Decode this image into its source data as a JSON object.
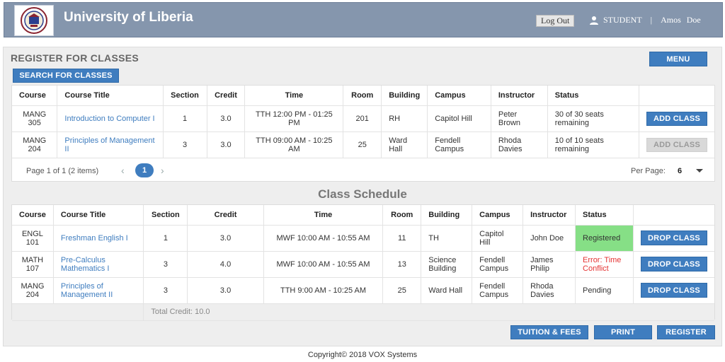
{
  "header": {
    "app_title": "University of Liberia",
    "logout_label": "Log Out",
    "role": "STUDENT",
    "separator": "|",
    "first_name": "Amos",
    "last_name": "Doe"
  },
  "register": {
    "title": "REGISTER FOR CLASSES",
    "menu_label": "MENU",
    "search_label": "SEARCH FOR CLASSES",
    "columns": [
      "Course",
      "Course Title",
      "Section",
      "Credit",
      "Time",
      "Room",
      "Building",
      "Campus",
      "Instructor",
      "Status"
    ],
    "rows": [
      {
        "course": "MANG 305",
        "title": "Introduction to Computer I",
        "section": "1",
        "credit": "3.0",
        "time": "TTH 12:00 PM - 01:25 PM",
        "room": "201",
        "building": "RH",
        "campus": "Capitol Hill",
        "instructor": "Peter Brown",
        "status": "30 of 30 seats remaining",
        "action": "ADD CLASS"
      },
      {
        "course": "MANG 204",
        "title": "Principles of Management II",
        "section": "3",
        "credit": "3.0",
        "time": "TTH 09:00 AM - 10:25 AM",
        "room": "25",
        "building": "Ward Hall",
        "campus": "Fendell Campus",
        "instructor": "Rhoda Davies",
        "status": "10 of 10 seats remaining",
        "action": "ADD CLASS"
      }
    ],
    "pager": {
      "summary": "Page 1 of 1 (2 items)",
      "prev": "‹",
      "page": "1",
      "next": "›",
      "per_page_label": "Per Page:",
      "per_page_value": "6"
    }
  },
  "schedule": {
    "title": "Class Schedule",
    "columns": [
      "Course",
      "Course Title",
      "Section",
      "Credit",
      "Time",
      "Room",
      "Building",
      "Campus",
      "Instructor",
      "Status"
    ],
    "rows": [
      {
        "course": "ENGL 101",
        "title": "Freshman English I",
        "section": "1",
        "credit": "3.0",
        "time": "MWF 10:00 AM - 10:55 AM",
        "room": "11",
        "building": "TH",
        "campus": "Capitol Hill",
        "instructor": "John Doe",
        "status": "Registered",
        "action": "DROP CLASS"
      },
      {
        "course": "MATH 107",
        "title": "Pre-Calculus Mathematics I",
        "section": "3",
        "credit": "4.0",
        "time": "MWF 10:00 AM - 10:55 AM",
        "room": "13",
        "building": "Science Building",
        "campus": "Fendell Campus",
        "instructor": "James Philip",
        "status": "Error: Time Conflict",
        "action": "DROP CLASS"
      },
      {
        "course": "MANG 204",
        "title": "Principles of Management II",
        "section": "3",
        "credit": "3.0",
        "time": "TTH 9:00 AM - 10:25 AM",
        "room": "25",
        "building": "Ward Hall",
        "campus": "Fendell Campus",
        "instructor": "Rhoda Davies",
        "status": "Pending",
        "action": "DROP CLASS"
      }
    ],
    "total": "Total Credit: 10.0"
  },
  "footer_buttons": {
    "tuition": "TUITION & FEES",
    "print": "PRINT",
    "register": "REGISTER"
  },
  "copyright": "Copyright© 2018 VOX Systems",
  "colors": {
    "header_bg": "#8596ad",
    "button_blue": "#3f7dbf",
    "registered_green": "#86df86",
    "error_red": "#e53333"
  }
}
